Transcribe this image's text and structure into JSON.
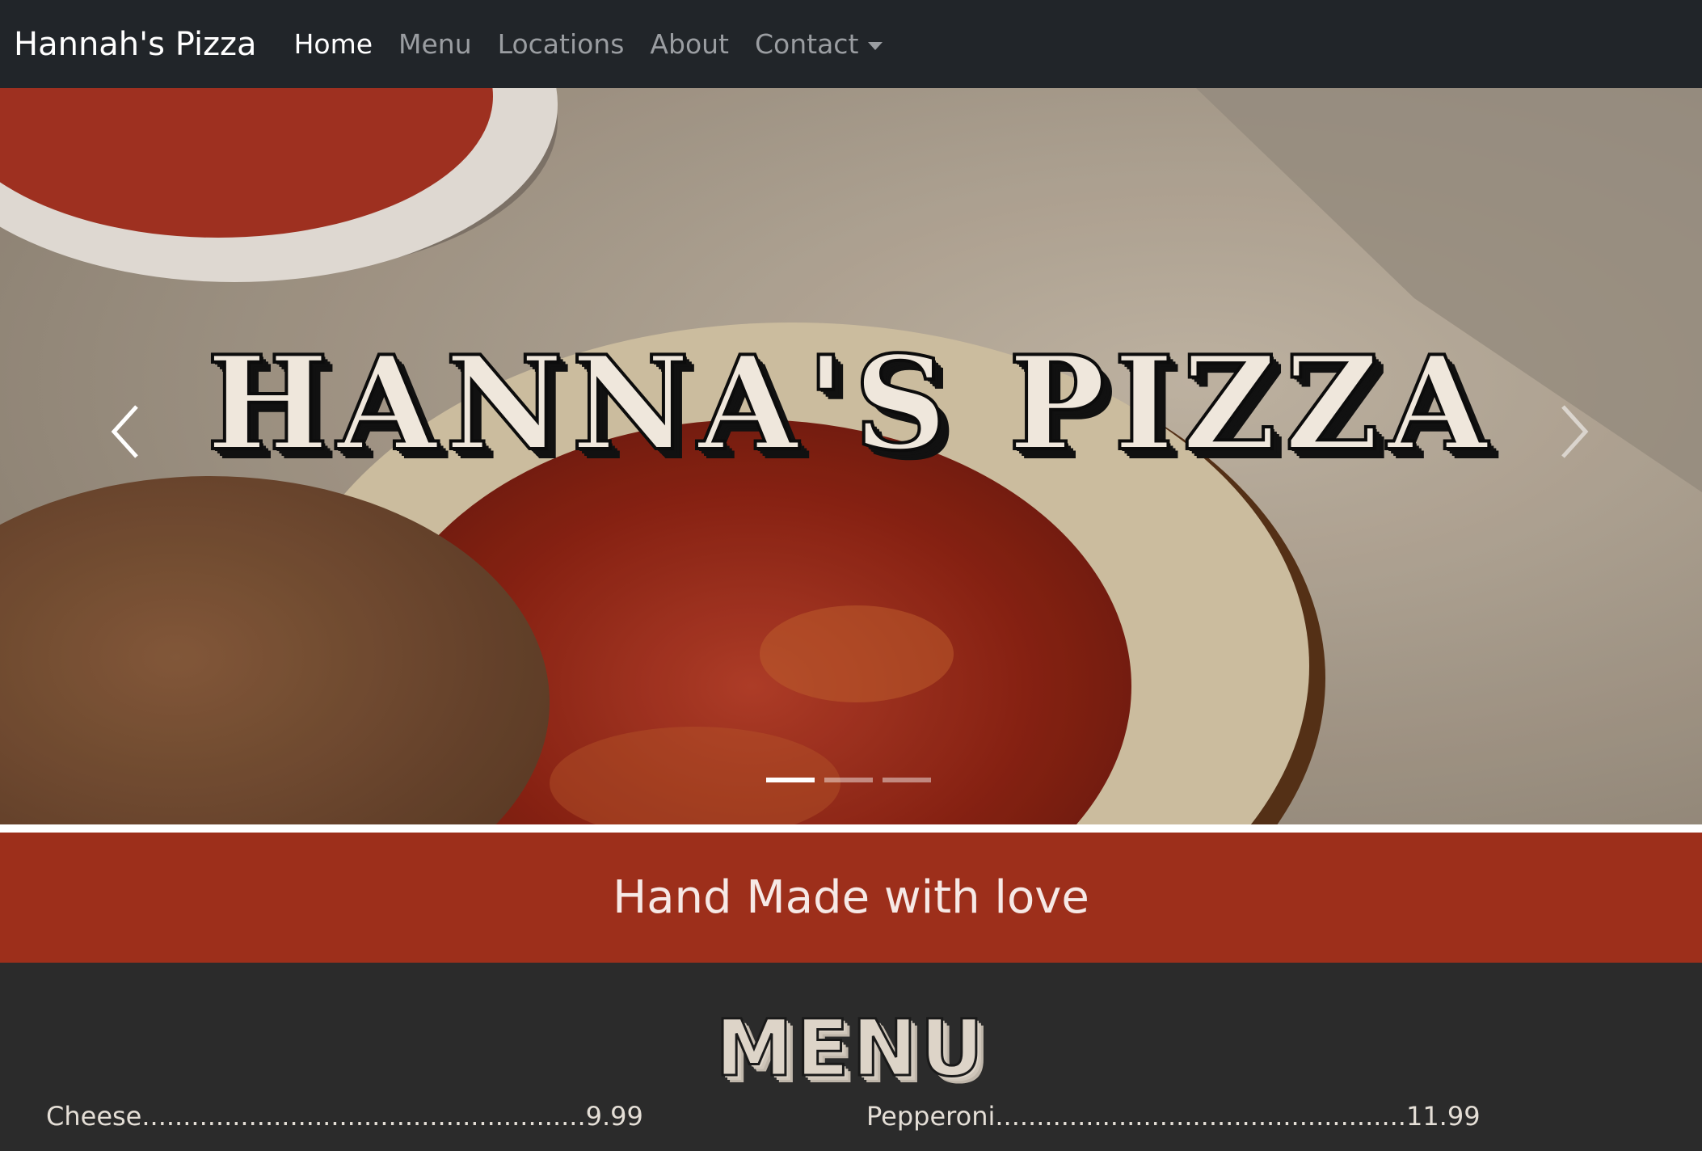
{
  "navbar": {
    "brand": "Hannah's Pizza",
    "links": [
      {
        "label": "Home",
        "active": true
      },
      {
        "label": "Menu"
      },
      {
        "label": "Locations"
      },
      {
        "label": "About"
      },
      {
        "label": "Contact",
        "dropdown": true
      }
    ],
    "background": "#212529"
  },
  "carousel": {
    "title": "HANNA'S PIZZA",
    "slide_count": 3,
    "active_slide": 1,
    "prev_icon": "chevron-left-icon",
    "next_icon": "chevron-right-icon"
  },
  "banner": {
    "text": "Hand Made with love",
    "background": "#9d2f1b"
  },
  "menu": {
    "heading": "MENU",
    "items": [
      {
        "name": "Cheese",
        "dots": "......................................................",
        "price": "9.99"
      },
      {
        "name": "Pepperoni",
        "dots": "..................................................",
        "price": "11.99"
      }
    ]
  }
}
